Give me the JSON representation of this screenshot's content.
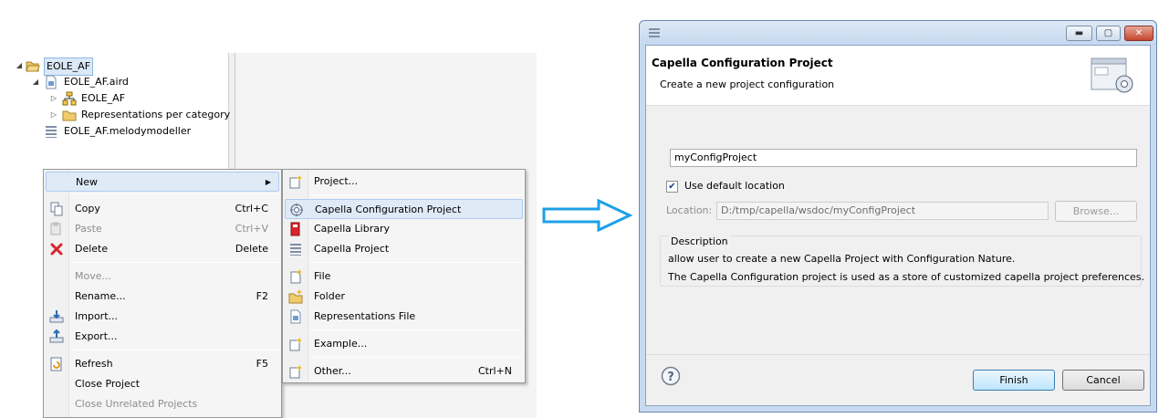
{
  "explorer": {
    "tree": [
      {
        "label": "EOLE_AF",
        "icon": "open-folder-icon",
        "expanded": true,
        "selected": true
      },
      {
        "label": "EOLE_AF.aird",
        "icon": "aird-file-icon",
        "expanded": true
      },
      {
        "label": "EOLE_AF",
        "icon": "model-icon",
        "expanded": false
      },
      {
        "label": "Representations per category",
        "icon": "folder-icon",
        "expanded": false
      },
      {
        "label": "EOLE_AF.melodymodeller",
        "icon": "melody-model-icon"
      }
    ]
  },
  "context_menu": {
    "items": [
      {
        "label": "New",
        "shortcut": "",
        "icon": "",
        "disabled": false,
        "has_submenu": true
      },
      {
        "label": "Copy",
        "shortcut": "Ctrl+C",
        "icon": "copy-icon",
        "disabled": false
      },
      {
        "label": "Paste",
        "shortcut": "Ctrl+V",
        "icon": "paste-icon",
        "disabled": true
      },
      {
        "label": "Delete",
        "shortcut": "Delete",
        "icon": "delete-icon",
        "disabled": false
      },
      {
        "label": "Move...",
        "shortcut": "",
        "icon": "",
        "disabled": true
      },
      {
        "label": "Rename...",
        "shortcut": "F2",
        "icon": "",
        "disabled": false
      },
      {
        "label": "Import...",
        "shortcut": "",
        "icon": "import-icon",
        "disabled": false
      },
      {
        "label": "Export...",
        "shortcut": "",
        "icon": "export-icon",
        "disabled": false
      },
      {
        "label": "Refresh",
        "shortcut": "F5",
        "icon": "refresh-icon",
        "disabled": false
      },
      {
        "label": "Close Project",
        "shortcut": "",
        "icon": "",
        "disabled": false
      },
      {
        "label": "Close Unrelated Projects",
        "shortcut": "",
        "icon": "",
        "disabled": true
      }
    ]
  },
  "submenu": {
    "items": [
      {
        "label": "Project...",
        "shortcut": "",
        "icon": "new-project-icon"
      },
      {
        "label": "Capella Configuration Project",
        "shortcut": "",
        "icon": "configuration-project-icon",
        "highlighted": true
      },
      {
        "label": "Capella Library",
        "shortcut": "",
        "icon": "library-icon"
      },
      {
        "label": "Capella Project",
        "shortcut": "",
        "icon": "capella-project-icon"
      },
      {
        "label": "File",
        "shortcut": "",
        "icon": "new-file-icon"
      },
      {
        "label": "Folder",
        "shortcut": "",
        "icon": "new-folder-icon"
      },
      {
        "label": "Representations File",
        "shortcut": "",
        "icon": "representations-file-icon"
      },
      {
        "label": "Example...",
        "shortcut": "",
        "icon": "example-icon"
      },
      {
        "label": "Other...",
        "shortcut": "Ctrl+N",
        "icon": "other-wizard-icon"
      }
    ]
  },
  "dialog": {
    "title": "Capella Configuration Project",
    "subtitle": "Create a new project configuration",
    "project_name": "myConfigProject",
    "use_default_label": "Use default location",
    "use_default_checked": true,
    "location_label": "Location:",
    "location_value": "D:/tmp/capella/wsdoc/myConfigProject",
    "browse_label": "Browse...",
    "description_title": "Description",
    "description_line1": "allow user to create a new Capella Project with Configuration Nature.",
    "description_line2": "The Capella Configuration project is used as a store of customized capella project preferences.",
    "finish_label": "Finish",
    "cancel_label": "Cancel",
    "help_icon": "question-icon"
  },
  "colors": {
    "arrow": "#1ea0e6",
    "menu_highlight": "#dfeaf7",
    "delete_red": "#d8262e"
  }
}
